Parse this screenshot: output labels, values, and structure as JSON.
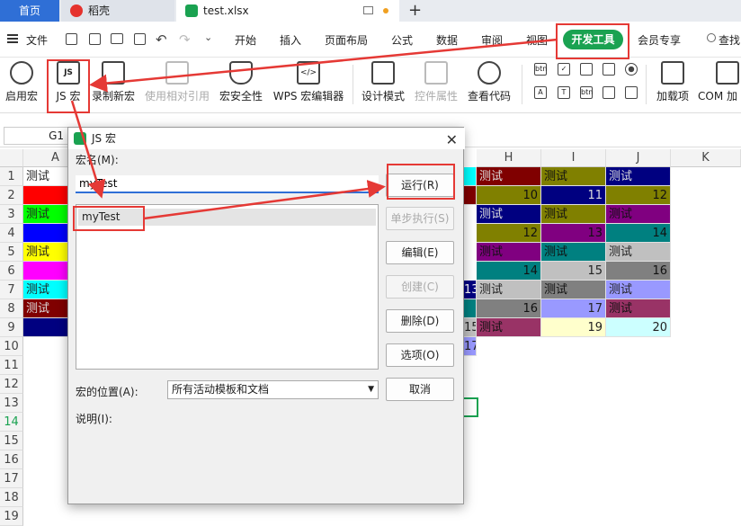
{
  "tabs": {
    "home": "首页",
    "daoke": "稻壳",
    "file": "test.xlsx",
    "add": "+"
  },
  "menu": {
    "file": "文件",
    "items": [
      "开始",
      "插入",
      "页面布局",
      "公式",
      "数据",
      "审阅",
      "视图"
    ],
    "devtools": "开发工具",
    "member": "会员专享",
    "search": "查找"
  },
  "ribbon": {
    "enable_macro": "启用宏",
    "js_macro": "JS 宏",
    "record": "录制新宏",
    "relative": "使用相对引用",
    "security": "宏安全性",
    "wps_editor": "WPS 宏编辑器",
    "design_mode": "设计模式",
    "control_props": "控件属性",
    "view_code": "查看代码",
    "addins": "加载项",
    "com": "COM 加"
  },
  "formula": {
    "cell_ref": "G1"
  },
  "sheet": {
    "columns": [
      "A",
      "H",
      "I",
      "J",
      "K"
    ],
    "rows": [
      "1",
      "2",
      "3",
      "4",
      "5",
      "6",
      "7",
      "8",
      "9",
      "10",
      "11",
      "12",
      "13",
      "14",
      "15",
      "16",
      "17",
      "18",
      "19"
    ],
    "cells": [
      {
        "r": 0,
        "c": "A",
        "v": "测试",
        "bg": "#ffffff"
      },
      {
        "r": 1,
        "c": "A",
        "v": "",
        "bg": "#ff0000"
      },
      {
        "r": 2,
        "c": "A",
        "v": "测试",
        "bg": "#00ff00"
      },
      {
        "r": 3,
        "c": "A",
        "v": "",
        "bg": "#0000ff"
      },
      {
        "r": 4,
        "c": "A",
        "v": "测试",
        "bg": "#ffff00"
      },
      {
        "r": 5,
        "c": "A",
        "v": "",
        "bg": "#ff00ff"
      },
      {
        "r": 6,
        "c": "A",
        "v": "测试",
        "bg": "#00ffff"
      },
      {
        "r": 7,
        "c": "A",
        "v": "测试",
        "bg": "#800000"
      },
      {
        "r": 8,
        "c": "A",
        "v": "",
        "bg": "#000080"
      },
      {
        "r": 0,
        "c": "H",
        "v": "测试",
        "bg": "#800000"
      },
      {
        "r": 0,
        "c": "I",
        "v": "测试",
        "bg": "#808000"
      },
      {
        "r": 0,
        "c": "J",
        "v": "测试",
        "bg": "#000080"
      },
      {
        "r": 1,
        "c": "H",
        "v": "10",
        "bg": "#808000",
        "num": true
      },
      {
        "r": 1,
        "c": "I",
        "v": "11",
        "bg": "#000080",
        "num": true
      },
      {
        "r": 1,
        "c": "J",
        "v": "12",
        "bg": "#808000",
        "num": true
      },
      {
        "r": 2,
        "c": "H",
        "v": "测试",
        "bg": "#000080"
      },
      {
        "r": 2,
        "c": "I",
        "v": "测试",
        "bg": "#808000"
      },
      {
        "r": 2,
        "c": "J",
        "v": "测试",
        "bg": "#800080"
      },
      {
        "r": 3,
        "c": "H",
        "v": "12",
        "bg": "#808000",
        "num": true
      },
      {
        "r": 3,
        "c": "I",
        "v": "13",
        "bg": "#800080",
        "num": true
      },
      {
        "r": 3,
        "c": "J",
        "v": "14",
        "bg": "#008080",
        "num": true
      },
      {
        "r": 4,
        "c": "H",
        "v": "测试",
        "bg": "#800080"
      },
      {
        "r": 4,
        "c": "I",
        "v": "测试",
        "bg": "#008080"
      },
      {
        "r": 4,
        "c": "J",
        "v": "测试",
        "bg": "#c0c0c0"
      },
      {
        "r": 5,
        "c": "H",
        "v": "14",
        "bg": "#008080",
        "num": true
      },
      {
        "r": 5,
        "c": "I",
        "v": "15",
        "bg": "#c0c0c0",
        "num": true
      },
      {
        "r": 5,
        "c": "J",
        "v": "16",
        "bg": "#808080",
        "num": true
      },
      {
        "r": 6,
        "c": "H",
        "v": "测试",
        "bg": "#c0c0c0"
      },
      {
        "r": 6,
        "c": "I",
        "v": "测试",
        "bg": "#808080"
      },
      {
        "r": 6,
        "c": "J",
        "v": "测试",
        "bg": "#9999ff"
      },
      {
        "r": 7,
        "c": "H",
        "v": "16",
        "bg": "#808080",
        "num": true
      },
      {
        "r": 7,
        "c": "I",
        "v": "17",
        "bg": "#9999ff",
        "num": true
      },
      {
        "r": 7,
        "c": "J",
        "v": "测试",
        "bg": "#993366"
      },
      {
        "r": 8,
        "c": "H",
        "v": "测试",
        "bg": "#993366"
      },
      {
        "r": 8,
        "c": "I",
        "v": "19",
        "bg": "#ffffcc",
        "num": true
      },
      {
        "r": 8,
        "c": "J",
        "v": "20",
        "bg": "#ccffff",
        "num": true
      }
    ]
  },
  "dialog": {
    "title": "JS 宏",
    "macro_name_label": "宏名(M):",
    "macro_name_value": "myTest",
    "list_items": [
      "myTest"
    ],
    "buttons": {
      "run": "运行(R)",
      "step": "单步执行(S)",
      "edit": "编辑(E)",
      "create": "创建(C)",
      "delete": "删除(D)",
      "options": "选项(O)",
      "cancel": "取消"
    },
    "location_label": "宏的位置(A):",
    "location_value": "所有活动模板和文档",
    "description_label": "说明(I):"
  },
  "colors": {
    "accent": "#1aa251",
    "annotation": "#e53935",
    "tab_active": "#2f6fd6"
  }
}
